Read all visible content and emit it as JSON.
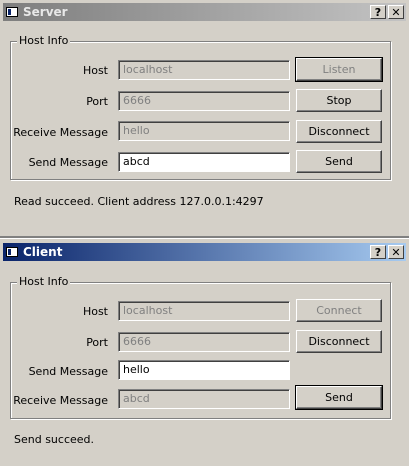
{
  "server": {
    "title": "Server",
    "group_title": "Host Info",
    "host_label": "Host",
    "host_value": "localhost",
    "port_label": "Port",
    "port_value": "6666",
    "receive_label": "Receive Message",
    "receive_value": "hello",
    "send_label": "Send Message",
    "send_value": "abcd",
    "listen_button": "Listen",
    "stop_button": "Stop",
    "disconnect_button": "Disconnect",
    "send_button": "Send",
    "status": "Read succeed. Client address 127.0.0.1:4297"
  },
  "client": {
    "title": "Client",
    "group_title": "Host Info",
    "host_label": "Host",
    "host_value": "localhost",
    "port_label": "Port",
    "port_value": "6666",
    "send_label": "Send Message",
    "send_value": "hello",
    "receive_label": "Receive Message",
    "receive_value": "abcd",
    "connect_button": "Connect",
    "disconnect_button": "Disconnect",
    "send_button": "Send",
    "status": "Send succeed."
  },
  "titlebar_buttons": {
    "help": "?",
    "close": "✕"
  },
  "colors": {
    "active_title": "#0a246a",
    "inactive_title": "#7e7e7e",
    "face": "#d4d0c8"
  }
}
